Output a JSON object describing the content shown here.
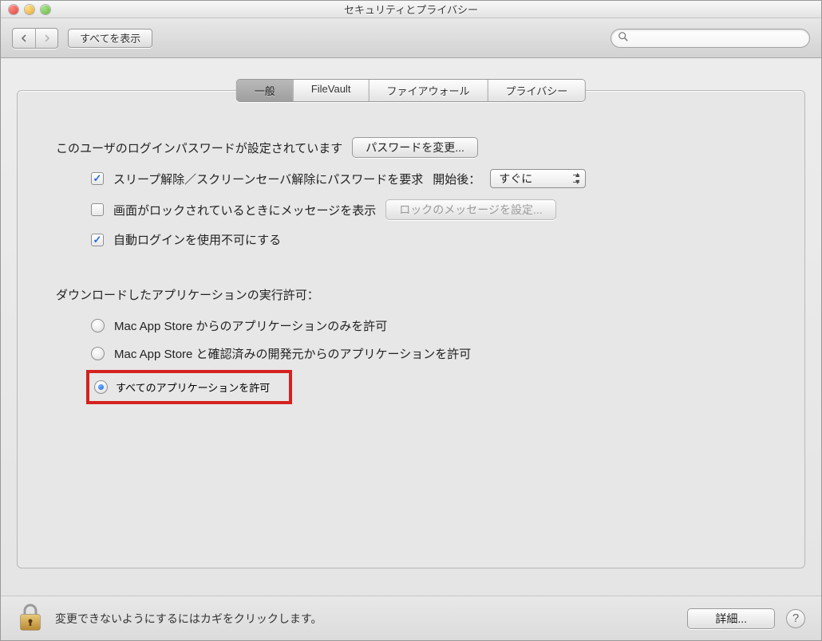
{
  "window": {
    "title": "セキュリティとプライバシー"
  },
  "toolbar": {
    "show_all": "すべてを表示",
    "search_placeholder": ""
  },
  "tabs": {
    "general": "一般",
    "filevault": "FileVault",
    "firewall": "ファイアウォール",
    "privacy": "プライバシー"
  },
  "general": {
    "password_set_text": "このユーザのログインパスワードが設定されています",
    "change_password_btn": "パスワードを変更...",
    "require_password_label": "スリープ解除／スクリーンセーバ解除にパスワードを要求",
    "require_password_after_label": "開始後：",
    "require_password_delay_value": "すぐに",
    "show_message_label": "画面がロックされているときにメッセージを表示",
    "set_lock_message_btn": "ロックのメッセージを設定...",
    "disable_autologin_label": "自動ログインを使用不可にする",
    "gatekeeper_header": "ダウンロードしたアプリケーションの実行許可：",
    "gatekeeper_opt_store": "Mac App Store からのアプリケーションのみを許可",
    "gatekeeper_opt_identified": "Mac App Store と確認済みの開発元からのアプリケーションを許可",
    "gatekeeper_opt_anywhere": "すべてのアプリケーションを許可"
  },
  "footer": {
    "lock_text": "変更できないようにするにはカギをクリックします。",
    "advanced_btn": "詳細..."
  }
}
